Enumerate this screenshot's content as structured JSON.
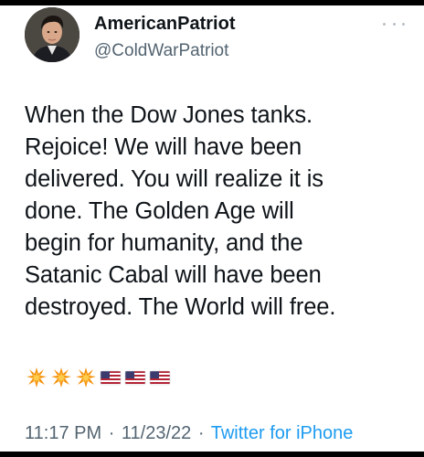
{
  "author": {
    "display_name": "AmericanPatriot",
    "handle": "@ColdWarPatriot"
  },
  "tweet": {
    "text": "When the Dow Jones tanks.\nRejoice! We will have been\ndelivered. You will realize it is\ndone. The Golden Age will\nbegin for humanity, and the\nSatanic Cabal will have been\ndestroyed. The World will free.",
    "emojis": [
      "collision-icon",
      "collision-icon",
      "collision-icon",
      "us-flag-icon",
      "us-flag-icon",
      "us-flag-icon"
    ]
  },
  "meta": {
    "time": "11:17 PM",
    "separator": "·",
    "date": "11/23/22",
    "source": "Twitter for iPhone"
  },
  "colors": {
    "text": "#0f1419",
    "secondary": "#536471",
    "link": "#1d9bf0",
    "frame": "#000000"
  }
}
